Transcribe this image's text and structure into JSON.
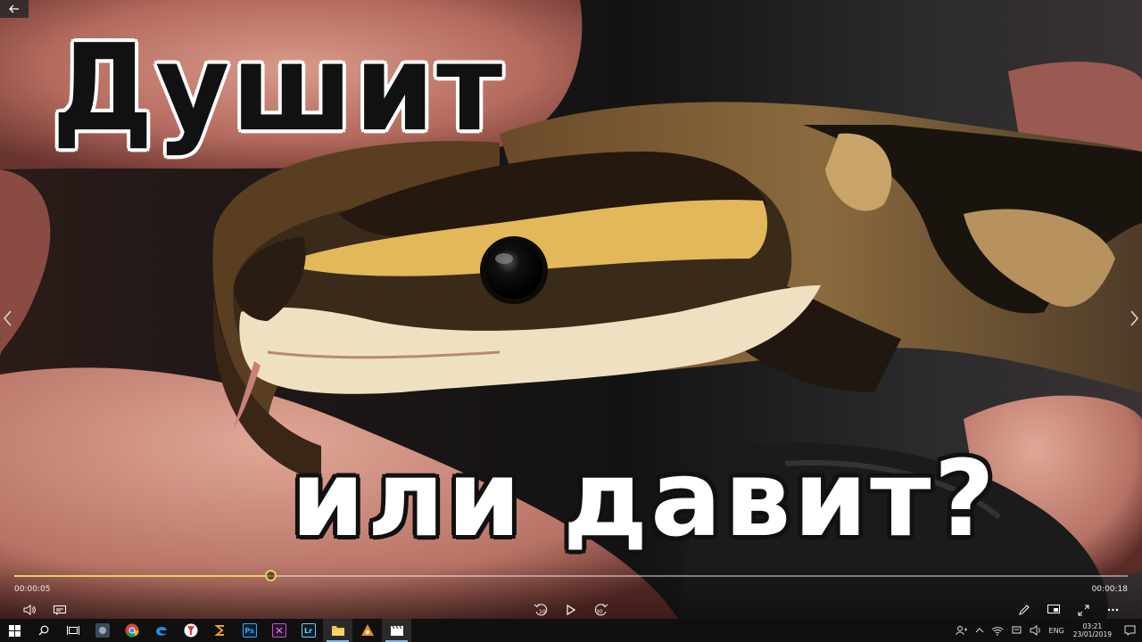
{
  "video": {
    "caption_top": "Душит",
    "caption_bottom": "или давит?"
  },
  "player": {
    "current_time": "00:00:05",
    "total_time": "00:00:18",
    "progress": 0.23,
    "accent_color": "#e6d25a",
    "skip_back_label": "10",
    "skip_forward_label": "30"
  },
  "taskbar": {
    "language": "ENG",
    "clock_time": "03:21",
    "clock_date": "23/01/2019",
    "apps": [
      {
        "name": "windows-start",
        "icon": "windows-logo-icon"
      },
      {
        "name": "search",
        "icon": "search-icon"
      },
      {
        "name": "task-view",
        "icon": "task-view-icon"
      },
      {
        "name": "app-generic",
        "icon": "app-icon"
      },
      {
        "name": "chrome",
        "icon": "chrome-icon"
      },
      {
        "name": "edge",
        "icon": "edge-icon"
      },
      {
        "name": "yandex",
        "icon": "yandex-icon"
      },
      {
        "name": "app-s",
        "icon": "s-app-icon"
      },
      {
        "name": "photoshop",
        "label": "Ps",
        "icon": "photoshop-icon"
      },
      {
        "name": "premiere-like",
        "icon": "media-app-icon"
      },
      {
        "name": "lightroom",
        "label": "Lr",
        "icon": "lightroom-icon"
      },
      {
        "name": "file-explorer",
        "icon": "folder-icon"
      },
      {
        "name": "vlc-like",
        "icon": "media-player-icon"
      },
      {
        "name": "movies-tv",
        "icon": "clapperboard-icon"
      }
    ]
  }
}
